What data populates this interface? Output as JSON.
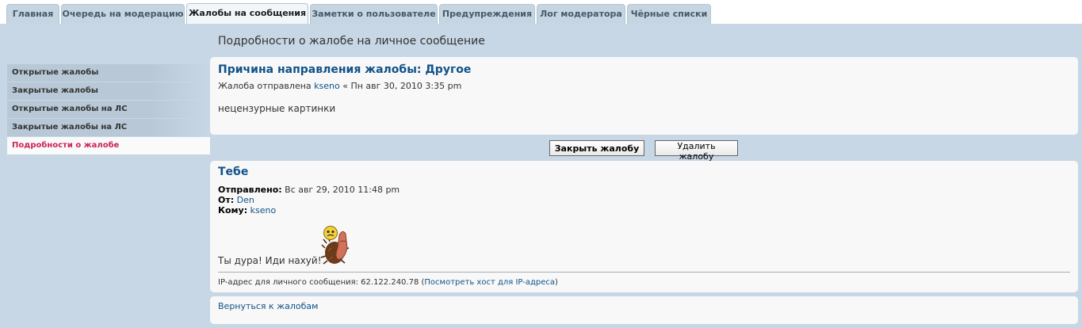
{
  "tabs": [
    {
      "label": "Главная",
      "active": false
    },
    {
      "label": "Очередь на модерацию",
      "active": false
    },
    {
      "label": "Жалобы на сообщения",
      "active": true
    },
    {
      "label": "Заметки о пользователе",
      "active": false
    },
    {
      "label": "Предупреждения",
      "active": false
    },
    {
      "label": "Лог модератора",
      "active": false
    },
    {
      "label": "Чёрные списки",
      "active": false
    }
  ],
  "page_title": "Подробности о жалобе на личное сообщение",
  "sidebar": {
    "items": [
      {
        "label": "Открытые жалобы"
      },
      {
        "label": "Закрытые жалобы"
      },
      {
        "label": "Открытые жалобы на ЛС"
      },
      {
        "label": "Закрытые жалобы на ЛС"
      },
      {
        "label": "Подробности о жалобе",
        "active": true
      }
    ]
  },
  "report": {
    "reason": "Причина направления жалобы: Другое",
    "sent_prefix": "Жалоба отправлена",
    "author": "kseno",
    "date_sep": " « ",
    "date": "Пн авг 30, 2010 3:35 pm",
    "text": "нецензурные картинки"
  },
  "buttons": {
    "close": "Закрыть жалобу",
    "delete": "Удалить жалобу"
  },
  "message": {
    "subject": "Тебе",
    "sent_label": "Отправлено:",
    "sent_value": "Вс авг 29, 2010 11:48 pm",
    "from_label": "От:",
    "from_value": "Den",
    "to_label": "Кому:",
    "to_value": "kseno",
    "body": "Ты дура! Иди нахуй!",
    "smiley_icon": "finger-smiley-icon",
    "ip_prefix": "IP-адрес для личного сообщения: 62.122.240.78 (",
    "ip_link": "Посмотреть хост для IP-адреса",
    "ip_suffix": ")"
  },
  "back_link": "Вернуться к жалобам",
  "colors": {
    "link": "#105289",
    "active_sidebar": "#cc2255",
    "background": "#c7d7e5"
  }
}
